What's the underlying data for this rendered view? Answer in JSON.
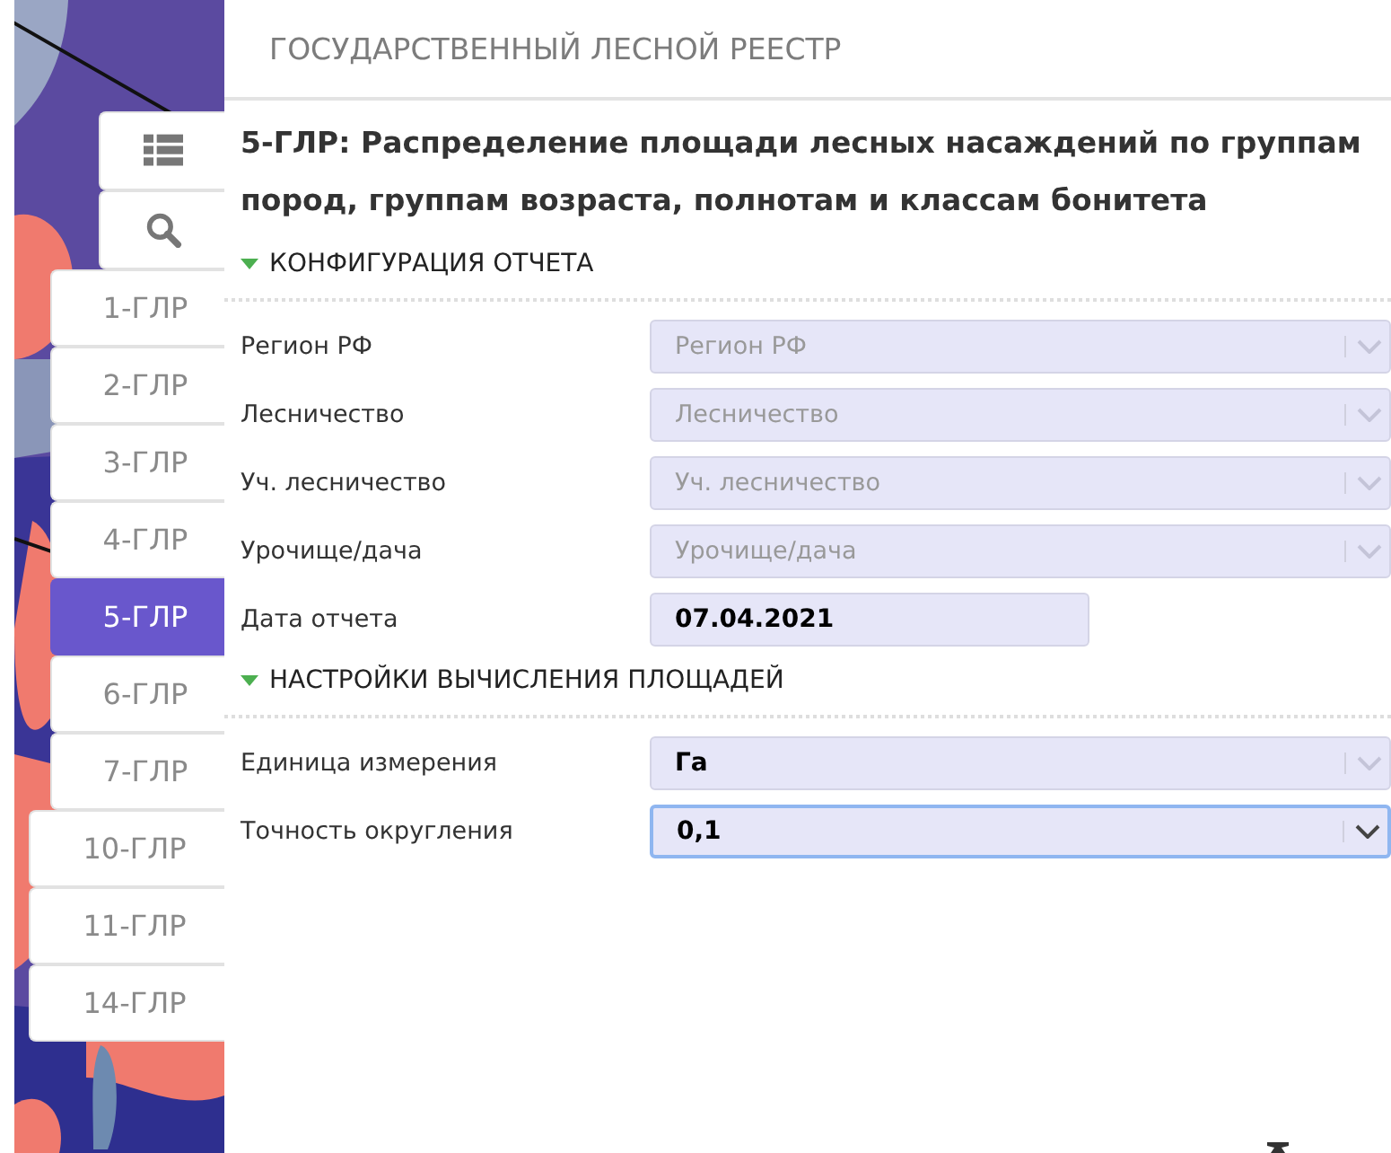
{
  "map_tools": [
    {
      "kind": "list"
    },
    {
      "kind": "search"
    }
  ],
  "report_tabs": [
    {
      "label": "1-ГЛР",
      "selected": false
    },
    {
      "label": "2-ГЛР",
      "selected": false
    },
    {
      "label": "3-ГЛР",
      "selected": false
    },
    {
      "label": "4-ГЛР",
      "selected": false
    },
    {
      "label": "5-ГЛР",
      "selected": true
    },
    {
      "label": "6-ГЛР",
      "selected": false
    },
    {
      "label": "7-ГЛР",
      "selected": false
    },
    {
      "label": "10-ГЛР",
      "selected": false
    },
    {
      "label": "11-ГЛР",
      "selected": false
    },
    {
      "label": "14-ГЛР",
      "selected": false
    }
  ],
  "header": {
    "title": "ГОСУДАРСТВЕННЫЙ ЛЕСНОЙ РЕЕСТР"
  },
  "report_title": "5-ГЛР: Распределение площади лесных насаждений по группам пород, группам возраста, полнотам и классам бонитета",
  "sections": [
    {
      "title": "КОНФИГУРАЦИЯ ОТЧЕТА",
      "expanded": true,
      "fields": [
        {
          "label": "Регион РФ",
          "kind": "select",
          "placeholder": "Регион РФ",
          "disabled": true,
          "focused": false
        },
        {
          "label": "Лесничество",
          "kind": "select",
          "placeholder": "Лесничество",
          "disabled": true,
          "focused": false
        },
        {
          "label": "Уч. лесничество",
          "kind": "select",
          "placeholder": "Уч. лесничество",
          "disabled": true,
          "focused": false
        },
        {
          "label": "Урочище/дача",
          "kind": "select",
          "placeholder": "Урочище/дача",
          "disabled": true,
          "focused": false
        },
        {
          "label": "Дата отчета",
          "kind": "date",
          "value": "07.04.2021",
          "disabled": false,
          "focused": false
        }
      ]
    },
    {
      "title": "НАСТРОЙКИ ВЫЧИСЛЕНИЯ ПЛОЩАДЕЙ",
      "expanded": true,
      "fields": [
        {
          "label": "Единица измерения",
          "kind": "select",
          "value": "Га",
          "disabled": true,
          "focused": false
        },
        {
          "label": "Точность округления",
          "kind": "select",
          "value": "0,1",
          "disabled": false,
          "focused": true
        }
      ]
    }
  ]
}
